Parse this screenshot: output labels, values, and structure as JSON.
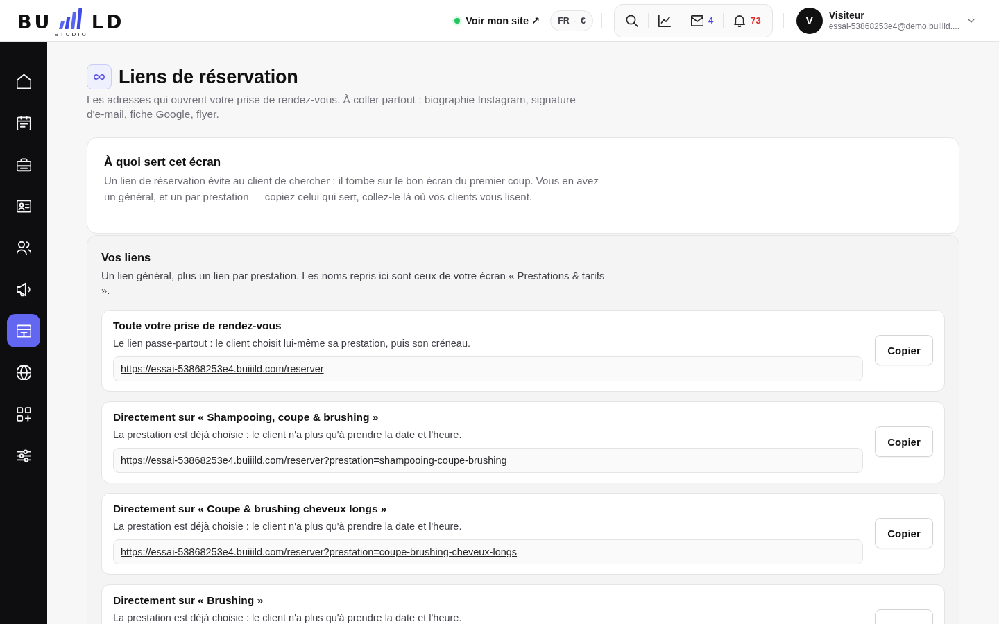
{
  "topbar": {
    "logo": {
      "left": "BU",
      "right": "LD",
      "tagline": "STUDIO"
    },
    "site_link": {
      "label": "Voir mon site ↗",
      "live": true
    },
    "locale": {
      "language": "FR",
      "separator": "·",
      "currency": "€"
    },
    "tools": [
      {
        "kind": "search"
      },
      {
        "kind": "chart"
      },
      {
        "kind": "mail",
        "count": "4",
        "color": "#4f46e5"
      },
      {
        "kind": "bell",
        "count": "73",
        "color": "#dc2626"
      }
    ],
    "user": {
      "initial": "V",
      "name": "Visiteur",
      "email": "essai-53868253e4@demo.buiiild...."
    }
  },
  "sidebar": {
    "items": [
      {
        "kind": "home",
        "selected": false
      },
      {
        "kind": "calendar",
        "selected": false
      },
      {
        "kind": "toolbox",
        "selected": false
      },
      {
        "kind": "idcard",
        "selected": false
      },
      {
        "kind": "users",
        "selected": false
      },
      {
        "kind": "megaphone",
        "selected": false
      },
      {
        "kind": "card",
        "selected": true
      },
      {
        "kind": "globe",
        "selected": false
      },
      {
        "kind": "apps",
        "selected": false
      },
      {
        "kind": "sliders",
        "selected": false
      }
    ]
  },
  "page": {
    "title": "Liens de réservation",
    "subtitle": "Les adresses qui ouvrent votre prise de rendez-vous. À coller partout : biographie Instagram, signature d'e-mail, fiche Google, flyer."
  },
  "intro_card": {
    "title": "À quoi sert cet écran",
    "text": "Un lien de réservation évite au client de chercher : il tombe sur le bon écran du premier coup. Vous en avez un général, et un par prestation — copiez celui qui sert, collez-le là où vos clients vous lisent."
  },
  "links_section": {
    "title": "Vos liens",
    "description": "Un lien général, plus un lien par prestation. Les noms repris ici sont ceux de votre écran « Prestations & tarifs ».",
    "links": [
      {
        "title": "Toute votre prise de rendez-vous",
        "description": "Le lien passe-partout : le client choisit lui-même sa prestation, puis son créneau.",
        "url": "https://essai-53868253e4.buiiild.com/reserver",
        "button": "Copier"
      },
      {
        "title": "Directement sur « Shampooing, coupe & brushing »",
        "description": "La prestation est déjà choisie : le client n'a plus qu'à prendre la date et l'heure.",
        "url": "https://essai-53868253e4.buiiild.com/reserver?prestation=shampooing-coupe-brushing",
        "button": "Copier"
      },
      {
        "title": "Directement sur « Coupe & brushing cheveux longs »",
        "description": "La prestation est déjà choisie : le client n'a plus qu'à prendre la date et l'heure.",
        "url": "https://essai-53868253e4.buiiild.com/reserver?prestation=coupe-brushing-cheveux-longs",
        "button": "Copier"
      },
      {
        "title": "Directement sur « Brushing »",
        "description": "La prestation est déjà choisie : le client n'a plus qu'à prendre la date et l'heure."
      }
    ]
  }
}
